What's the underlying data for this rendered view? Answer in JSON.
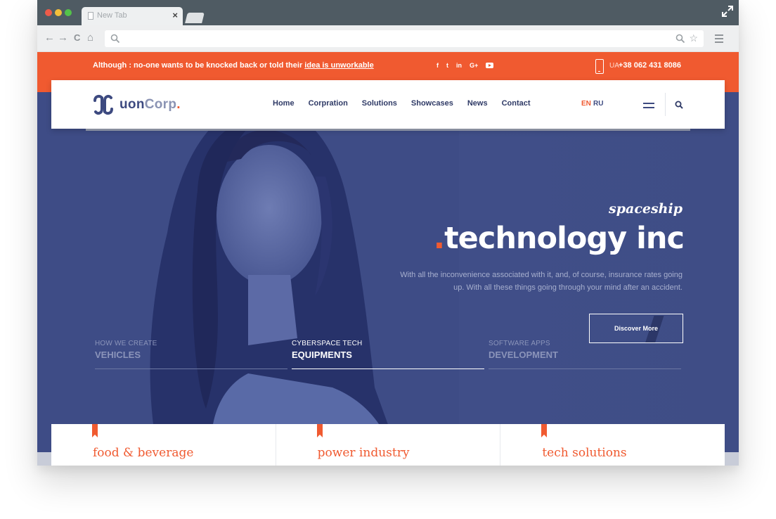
{
  "browser": {
    "tab_title": "New Tab",
    "tab_close": "×",
    "url_placeholder": "",
    "nav": {
      "back": "←",
      "forward": "→",
      "reload": "C",
      "home": "⌂",
      "star": "☆"
    }
  },
  "topbar": {
    "announce_prefix": "Although : no-one wants to be knocked back or told their ",
    "announce_link": "idea is unworkable",
    "socials": [
      "f",
      "t",
      "in",
      "G+"
    ],
    "phone_prefix": "UA",
    "phone_number": "+38 062 431 8086"
  },
  "header": {
    "logo": {
      "text_main": "u",
      "text_o": "o",
      "text_n": "n",
      "text_corp": "Corp",
      "text_dot": "."
    },
    "nav": [
      "Home",
      "Corpration",
      "Solutions",
      "Showcases",
      "News",
      "Contact"
    ],
    "languages": {
      "active": "EN",
      "other": "RU"
    }
  },
  "hero": {
    "subtitle": "spaceship",
    "headline_accent": ".",
    "headline": "technology inc",
    "description": "With all the inconvenience associated with it, and, of course, insurance rates going up. With all these things going through your mind after an accident.",
    "cta_label": "Discover More"
  },
  "feature_tabs": [
    {
      "small": "HOW WE CREATE",
      "big": "VEHICLES",
      "active": false
    },
    {
      "small": "CYBERSPACE TECH",
      "big": "EQUIPMENTS",
      "active": true
    },
    {
      "small": "SOFTWARE APPS",
      "big": "DEVELOPMENT",
      "active": false
    }
  ],
  "cards": [
    {
      "title": "food & beverage"
    },
    {
      "title": "power industry"
    },
    {
      "title": "tech solutions"
    }
  ],
  "colors": {
    "accent": "#f05a30",
    "hero_blue": "#3f4d86",
    "navy_text": "#2f3a66"
  }
}
